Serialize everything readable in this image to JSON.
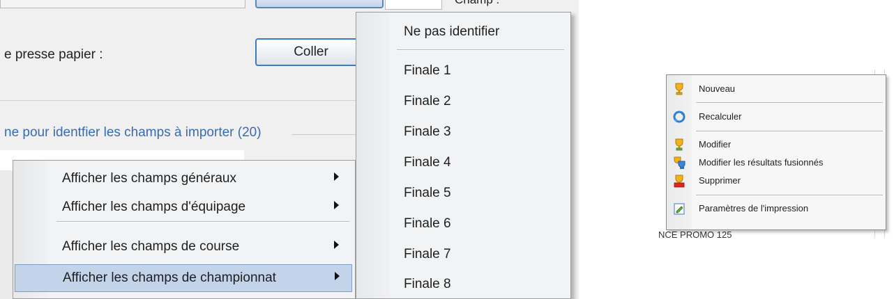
{
  "left_window": {
    "paste_label": "e presse papier :",
    "paste_button": "Coller",
    "group_title": "ne pour identfier les champs à importer (20)",
    "champ_label": "Champ :",
    "context_menu": {
      "items": [
        {
          "label": "Afficher les champs généraux"
        },
        {
          "label": "Afficher les champs d'équipage"
        },
        {
          "label": "Afficher les champs de course"
        },
        {
          "label": "Afficher les champs de championnat"
        }
      ]
    },
    "submenu": {
      "first": "Ne pas identifier",
      "items": [
        "Finale 1",
        "Finale 2",
        "Finale 3",
        "Finale 4",
        "Finale 5",
        "Finale 6",
        "Finale 7",
        "Finale 8"
      ]
    }
  },
  "right_window": {
    "menu": {
      "items": [
        {
          "label": "Nouveau",
          "icon": "trophy-new-icon"
        },
        {
          "label": "Recalculer",
          "icon": "recalculate-icon"
        },
        {
          "label": "Modifier",
          "icon": "trophy-edit-icon"
        },
        {
          "label": "Modifier les résultats fusionnés",
          "icon": "trophy-merge-icon"
        },
        {
          "label": "Supprimer",
          "icon": "trophy-delete-icon"
        },
        {
          "label": "Paramètres de l'impression",
          "icon": "print-settings-icon"
        }
      ]
    },
    "background_text": "NCE PROMO 125"
  },
  "colors": {
    "accent_blue": "#3a6ab0",
    "highlight": "#c2d3ea",
    "menu_bg": "#f2f3f4"
  }
}
